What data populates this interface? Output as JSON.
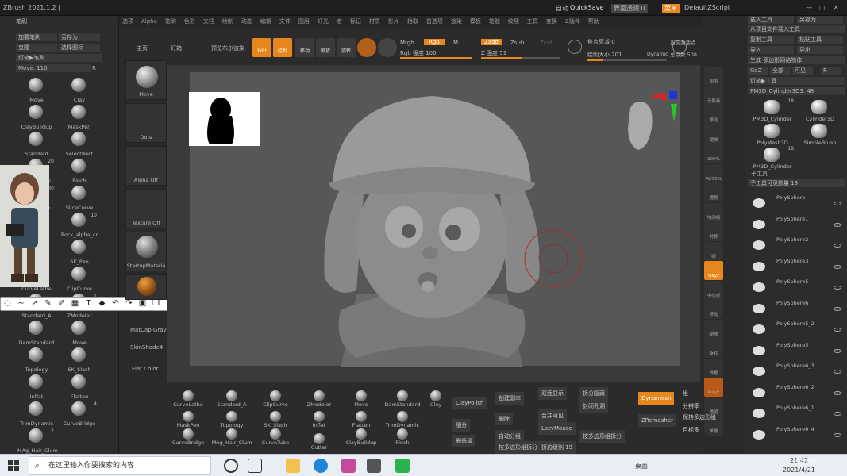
{
  "titlebar": {
    "app": "ZBrush 2021.1.2 |",
    "quicksave_prefix": "自动",
    "quicksave": "QuickSave",
    "transparency": "界面透明 0",
    "menu_btn": "菜单",
    "script": "DefaultZScript"
  },
  "menubar": [
    "选项",
    "Alpha",
    "笔刷",
    "色彩",
    "文档",
    "绘制",
    "动态",
    "编辑",
    "文件",
    "图层",
    "灯光",
    "宏",
    "标记",
    "材质",
    "影片",
    "拾取",
    "首选项",
    "渲染",
    "模板",
    "笔触",
    "纹理",
    "工具",
    "变换",
    "Z插件",
    "帮助"
  ],
  "toolbar": {
    "home": "主页",
    "lightbox": "灯箱",
    "preview": "预览布尔渲染",
    "edit": "Edit",
    "draw": "绘制",
    "move": "移动",
    "scale": "缩放",
    "rotate": "旋转",
    "mrgb": "Mrgb",
    "rgb": "Rgb",
    "m": "M",
    "zadd": "Zadd",
    "zsub": "Zsub",
    "zcut": "Zcut",
    "rgb_intensity": "Rgb 强度 100",
    "z_intensity": "Z 强度 51",
    "focal_shift": "焦点衰减 0",
    "draw_size": "绘制大小 201",
    "dynamic": "Dynamic",
    "active_points": "当前激活点",
    "total_points": "总点数 508",
    "rgb_level": 1.0,
    "z_level": 0.51,
    "size_level": 0.2
  },
  "leftpanel": {
    "title": "笔刷",
    "load": "加载笔刷",
    "saveas": "另存为",
    "clone": "克隆",
    "select": "选择图标",
    "lightbox_brush": "灯箱▶笔刷",
    "move_value": "Move. 110",
    "r": "R",
    "brushes": [
      {
        "name": "Move",
        "num": ""
      },
      {
        "name": "Clay",
        "num": ""
      },
      {
        "name": "ClayBuildup",
        "num": ""
      },
      {
        "name": "MaskPen",
        "num": ""
      },
      {
        "name": "Standard",
        "num": ""
      },
      {
        "name": "SelectRect",
        "num": ""
      },
      {
        "name": "IMM BParts",
        "num": "20"
      },
      {
        "name": "Pinch",
        "num": ""
      },
      {
        "name": "IMM Curve",
        "num": "30"
      },
      {
        "name": "SliceCurve",
        "num": ""
      },
      {
        "name": "SK_Hair",
        "num": ""
      },
      {
        "name": "Rock_alpha_cr",
        "num": "10"
      },
      {
        "name": "褶子笔刷",
        "num": ""
      },
      {
        "name": "SK_Pen",
        "num": ""
      },
      {
        "name": "CurveLathe",
        "num": ""
      },
      {
        "name": "ClipCurve",
        "num": ""
      },
      {
        "name": "Standard_A",
        "num": ""
      },
      {
        "name": "ZModeler",
        "num": "1"
      },
      {
        "name": "DamStandard",
        "num": ""
      },
      {
        "name": "Move",
        "num": ""
      },
      {
        "name": "Topology",
        "num": ""
      },
      {
        "name": "SK_Slash",
        "num": ""
      },
      {
        "name": "Inflat",
        "num": ""
      },
      {
        "name": "Flatten",
        "num": ""
      },
      {
        "name": "TrimDynamic",
        "num": ""
      },
      {
        "name": "CurveBridge",
        "num": "4"
      },
      {
        "name": "MAg_Hair_Clum",
        "num": "2"
      }
    ]
  },
  "matcol": {
    "move": "Move",
    "dots": "Dots",
    "alpha": "Alpha Off",
    "texture": "Texture Off",
    "material": "StartupMateria",
    "matcap": "MatCap Gray",
    "skin": "SkinShade4",
    "flat": "Flat Color"
  },
  "colors": {
    "accent": "#e8861e",
    "bg": "#2a2a2a",
    "panel": "#2c2c2c",
    "canvas": "#575757"
  },
  "color_picker": {
    "label": "交替"
  },
  "rightstrip": [
    "BPR",
    "子像素",
    "滚动",
    "缩放",
    "100%",
    "AC50%",
    "透视",
    "地网格",
    "对称",
    "帧",
    "Qxyz",
    "中心点",
    "移动",
    "缩放",
    "旋转",
    "线框",
    "PolyF",
    "透明",
    "单独"
  ],
  "rightpanel": {
    "load_tool": "载入工具",
    "saveas": "另存为",
    "from_project": "从项目文件载入工具",
    "copy_tool": "复制工具",
    "paste_tool": "粘贴工具",
    "import": "导入",
    "export": "导出",
    "gen_polymesh": "生成 多边形网格物体",
    "goz": "GoZ",
    "all": "全部",
    "visible": "可见",
    "r": "R",
    "lightbox_tool": "灯箱▶工具",
    "current_tool": "PM3D_Cylinder3D3. 48",
    "tools": [
      {
        "name": "PM3D_Cylinder",
        "num": "18"
      },
      {
        "name": "Cylinder3D",
        "num": ""
      },
      {
        "name": "PolyMesh3D",
        "num": ""
      },
      {
        "name": "SimpleBrush",
        "num": ""
      },
      {
        "name": "PM3D_Cylinder",
        "num": "18"
      }
    ],
    "subtool_title": "子工具",
    "subtool_count": "子工具可见数量 19",
    "subtools": [
      "PolySphere",
      "PolySphere1",
      "PolySphere2",
      "PolySphere3",
      "PolySphere5",
      "PolySphere6",
      "PolySphere5_2",
      "PolySphere5",
      "PolySphere6_3",
      "PolySphere6_2",
      "PolySphere6_1",
      "PolySphere6_4"
    ]
  },
  "bottompanel": {
    "brushes": [
      "CurveLathe",
      "Standard_A",
      "ClipCurve",
      "ZModeler",
      "Move",
      "DamStandard",
      "Clay",
      "MaskPen",
      "Topology",
      "SK_Slash",
      "Inflat",
      "Flatten",
      "TrimDynamic",
      "CurveBridge",
      "MAg_Hair_Clum",
      "CurveTube",
      "Cutter",
      "ClayBuildup",
      "Pinch"
    ],
    "claypolish": "ClayPolish",
    "smooth": "细分",
    "dellower": "删低级",
    "rebuild": "创建副本",
    "delete": "删除",
    "autogroup": "自动分组",
    "polygroup": "按多边形组拆分",
    "double": "双面显示",
    "split_hidden": "拆分隐藏",
    "merge_visible": "合并可见",
    "close_holes": "封闭孔洞",
    "lazymouse": "LazyMouse",
    "by_polygroup": "按多边形组拆分",
    "dynamesh": "Dynamesh",
    "group": "组",
    "resolution": "分辨率",
    "zremesher": "ZRemesher",
    "keep_groups": "保持多边形组",
    "target": "目标多",
    "poly_count": "折边级别 19"
  },
  "taskbar": {
    "search": "在这里输入你要搜索的内容",
    "desktop": "桌面",
    "time": "21:42",
    "date": "2021/4/21",
    "watermark": "阿军仔"
  }
}
